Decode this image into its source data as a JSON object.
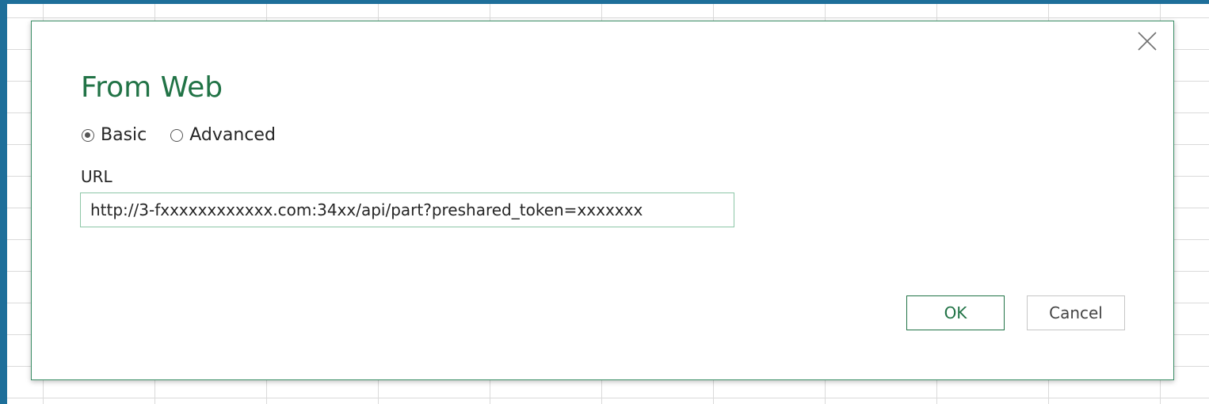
{
  "dialog": {
    "title": "From Web",
    "close_icon": "close-icon"
  },
  "mode": {
    "options": [
      {
        "label": "Basic",
        "selected": true
      },
      {
        "label": "Advanced",
        "selected": false
      }
    ]
  },
  "url": {
    "label": "URL",
    "value": "http://3-fxxxxxxxxxxxx.com:34xx/api/part?preshared_token=xxxxxxx"
  },
  "buttons": {
    "ok_label": "OK",
    "cancel_label": "Cancel"
  },
  "colors": {
    "accent": "#217346",
    "window_frame": "#1e6f9a",
    "input_border": "#8dc6a7"
  }
}
